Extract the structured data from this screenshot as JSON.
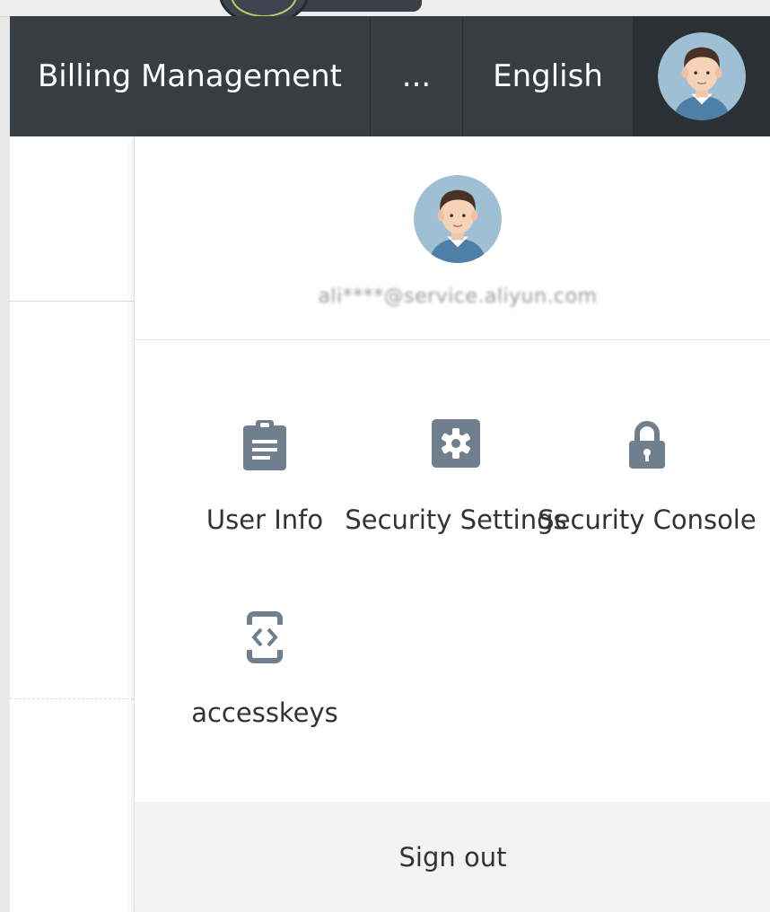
{
  "navbar": {
    "billing_label": "Billing Management",
    "more_label": "...",
    "language_label": "English",
    "avatar_icon": "user-avatar-icon"
  },
  "profile": {
    "email": "ali****@service.aliyun.com",
    "avatar_icon": "user-avatar-icon"
  },
  "menu": {
    "items": [
      {
        "label": "User Info",
        "icon": "clipboard-icon"
      },
      {
        "label": "Security Settings",
        "icon": "gear-icon"
      },
      {
        "label": "Security Console",
        "icon": "lock-icon"
      },
      {
        "label": "accesskeys",
        "icon": "code-brackets-icon"
      }
    ],
    "sign_out_label": "Sign out"
  },
  "colors": {
    "navbar_bg": "#373d41",
    "icon_color": "#6f7f8d",
    "signout_bg": "#f3f3f3"
  }
}
